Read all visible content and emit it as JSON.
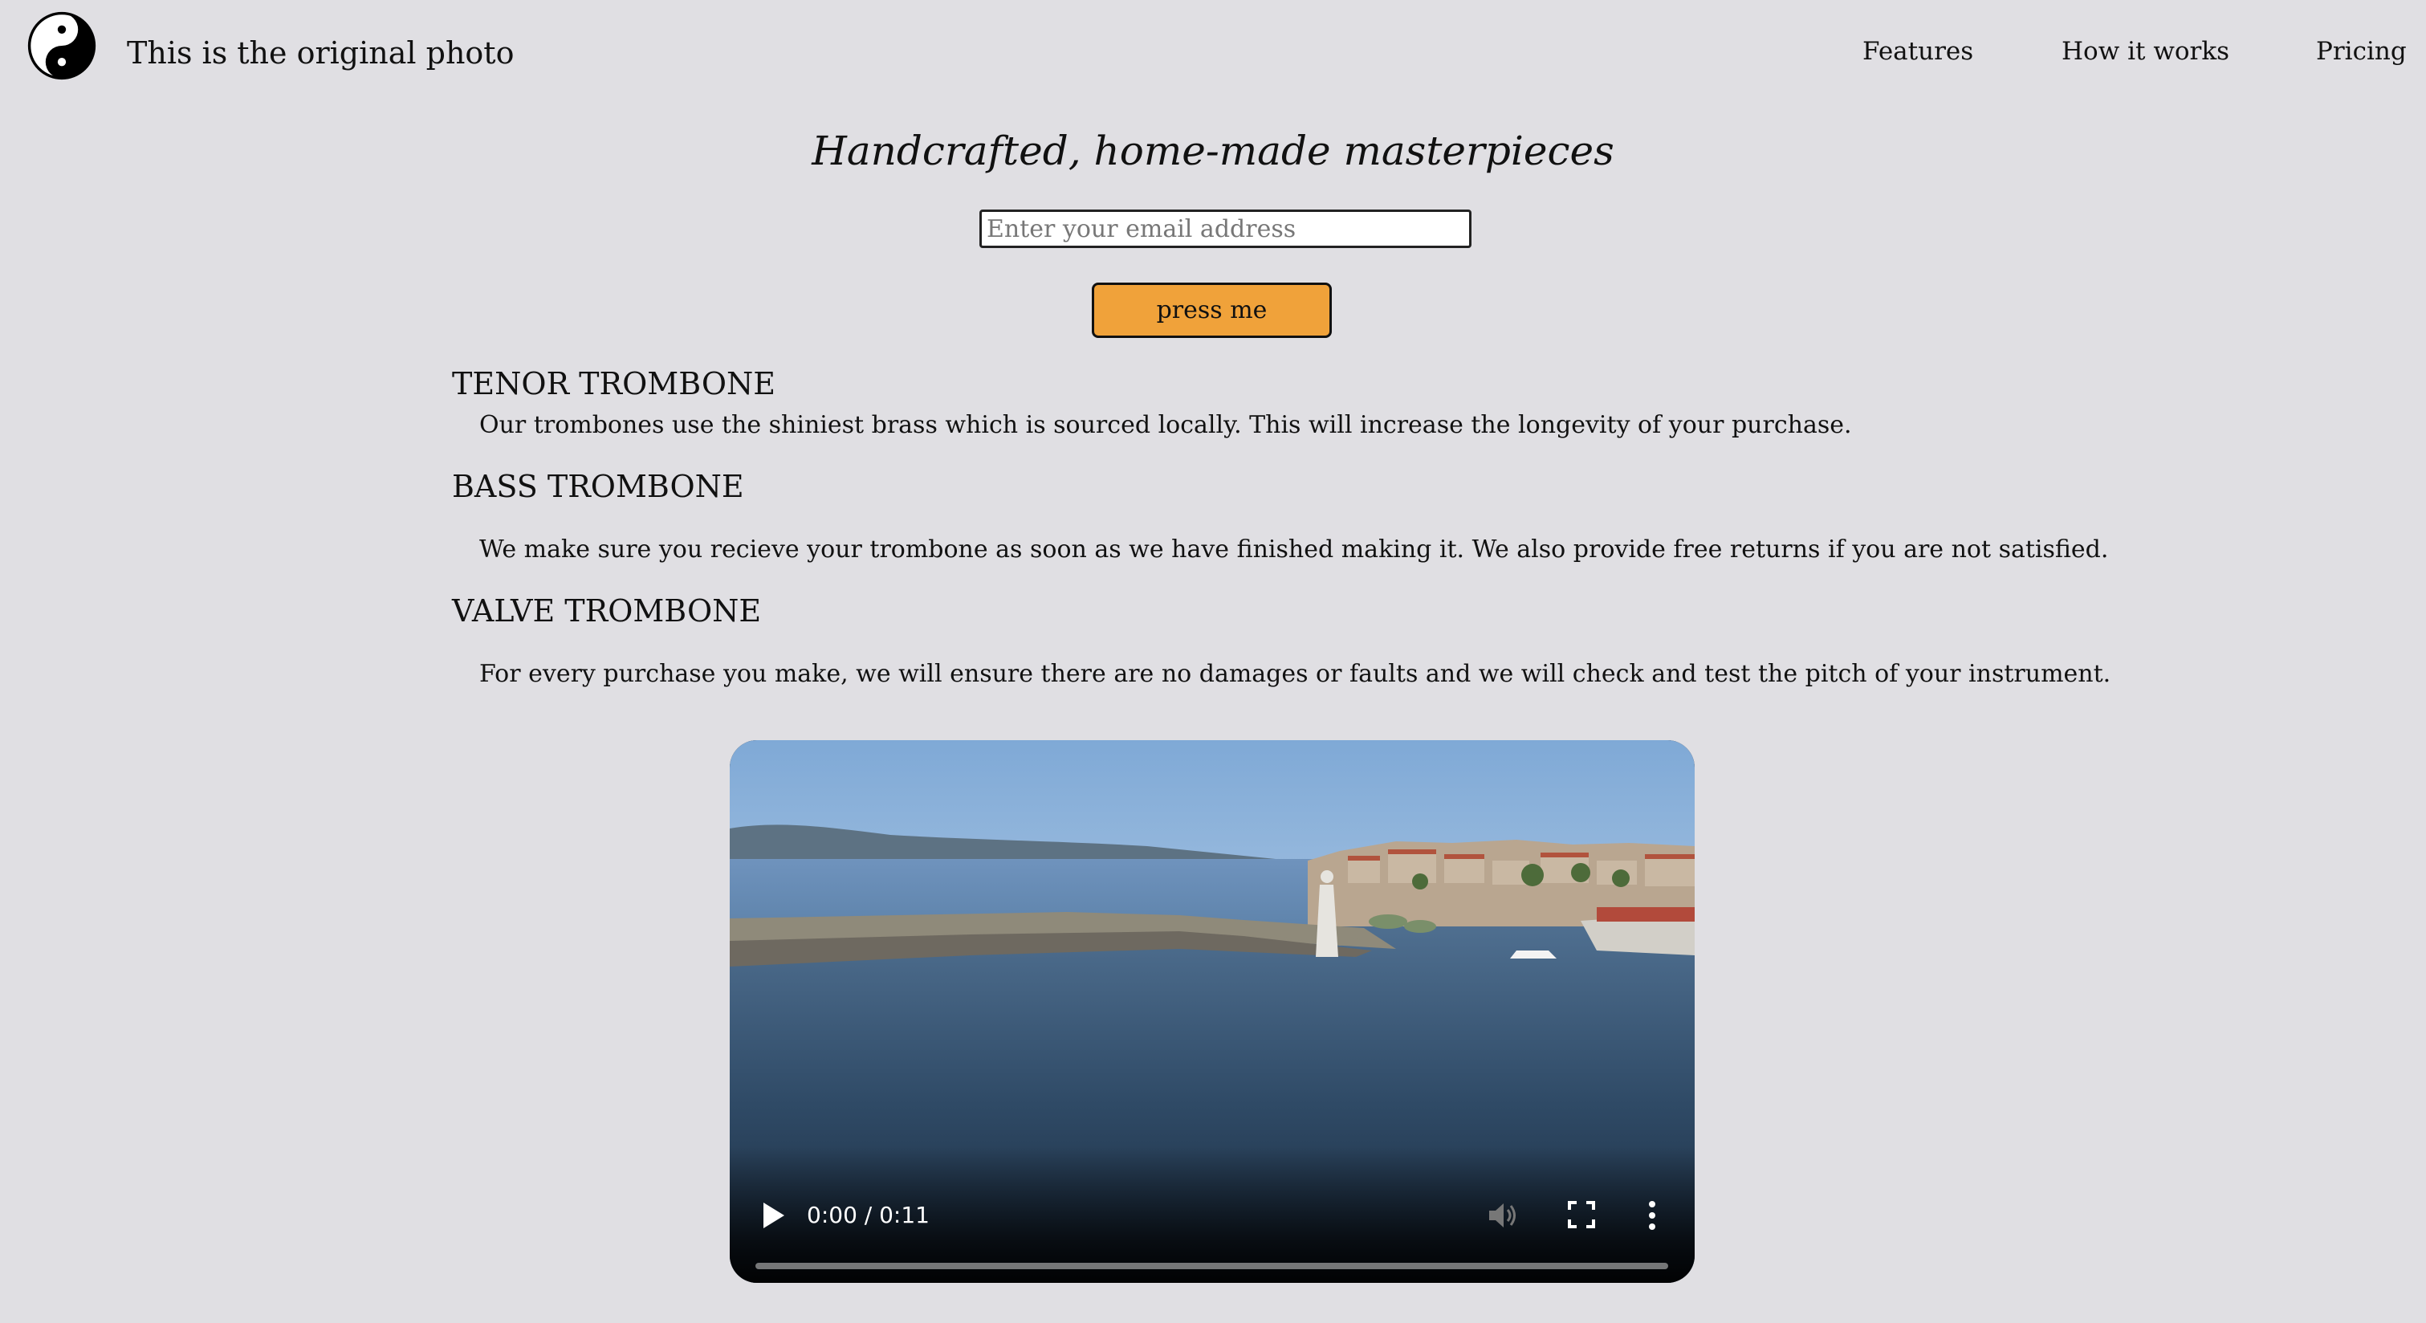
{
  "header": {
    "brand": "This is the original photo",
    "logo_icon": "yin-yang-icon",
    "nav": [
      {
        "label": "Features"
      },
      {
        "label": "How it works"
      },
      {
        "label": "Pricing"
      }
    ]
  },
  "hero": {
    "title": "Handcrafted, home-made masterpieces",
    "email_placeholder": "Enter your email address",
    "email_value": "",
    "button_label": "press me",
    "button_color": "#f0a23a"
  },
  "sections": [
    {
      "heading": "TENOR TROMBONE",
      "text": "Our trombones use the shiniest brass which is sourced locally. This will increase the longevity of your purchase."
    },
    {
      "heading": "BASS TROMBONE",
      "text": "We make sure you recieve your trombone as soon as we have finished making it. We also provide free returns if you are not satisfied."
    },
    {
      "heading": "VALVE TROMBONE",
      "text": "For every purchase you make, we will ensure there are no damages or faults and we will check and test the pitch of your instrument."
    }
  ],
  "video": {
    "time": "0:00 / 0:11",
    "progress_fraction": 0,
    "icons": [
      "play-icon",
      "mute-icon",
      "fullscreen-icon",
      "more-options-icon"
    ]
  },
  "colors": {
    "background": "#e0dfe3",
    "accent": "#f0a23a"
  }
}
